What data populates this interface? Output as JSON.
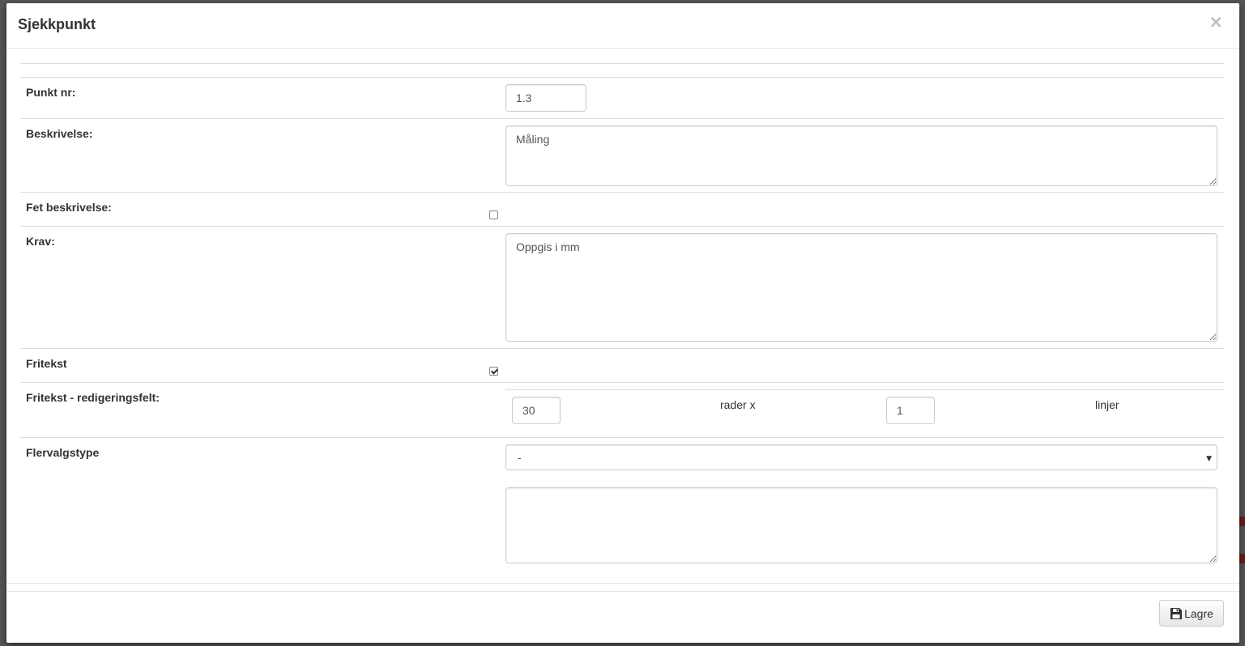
{
  "dialog": {
    "title": "Sjekkpunkt",
    "close_label": "×"
  },
  "form": {
    "punkt_nr": {
      "label": "Punkt nr:",
      "value": "1.3"
    },
    "beskrivelse": {
      "label": "Beskrivelse:",
      "value": "Måling"
    },
    "fet_beskrivelse": {
      "label": "Fet beskrivelse:",
      "checked": false
    },
    "krav": {
      "label": "Krav:",
      "value": "Oppgis i mm"
    },
    "fritekst": {
      "label": "Fritekst",
      "checked": true
    },
    "fritekst_felt": {
      "label": "Fritekst - redigeringsfelt:",
      "rows_value": "30",
      "rows_suffix": "rader x",
      "lines_value": "1",
      "lines_suffix": "linjer"
    },
    "flervalgstype": {
      "label": "Flervalgstype",
      "selected": "-",
      "options_text": ""
    }
  },
  "footer": {
    "save_label": "Lagre"
  }
}
